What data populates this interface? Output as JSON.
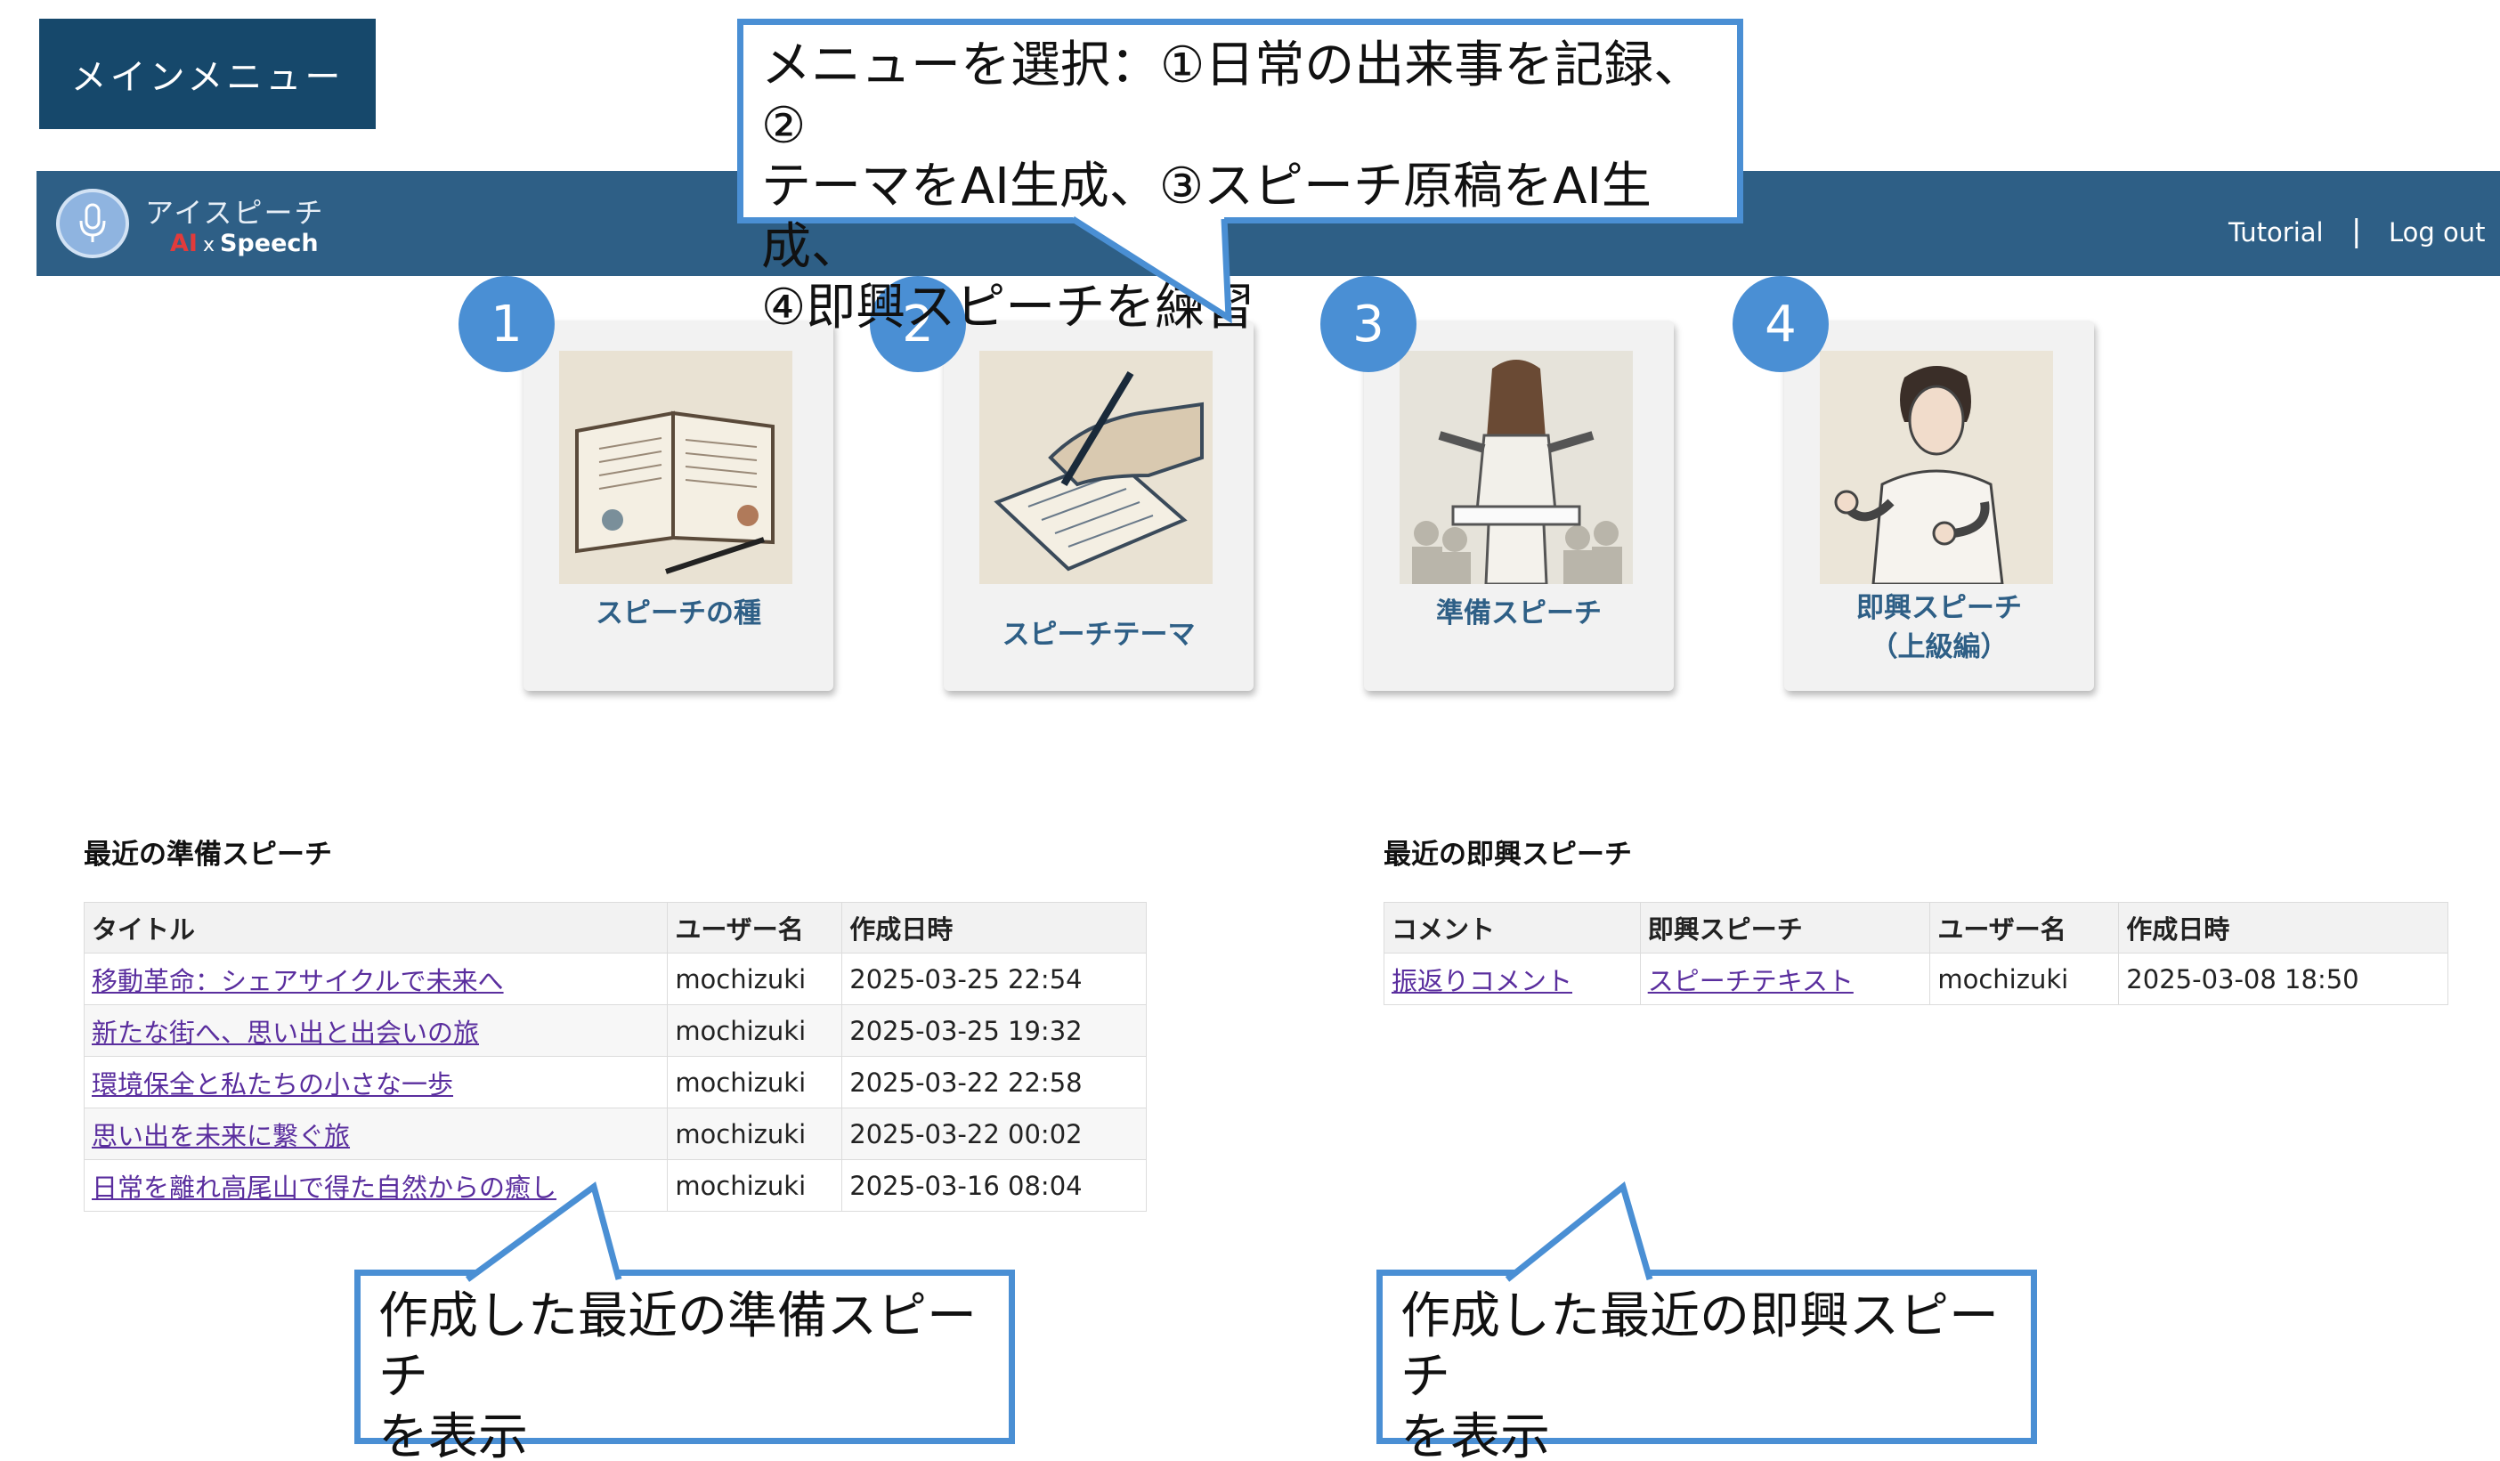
{
  "page_label": "メインメニュー",
  "header": {
    "brand_name": "アイスピーチ",
    "brand_sub_ai": "AI",
    "brand_sub_x": "x",
    "brand_sub_speech": "Speech",
    "nav_tutorial": "Tutorial",
    "nav_separator": "|",
    "nav_logout": "Log out"
  },
  "callouts": {
    "top_line1": "メニューを選択：①日常の出来事を記録、②",
    "top_line2": "テーマをAI生成、③スピーチ原稿をAI生成、",
    "top_line3": "④即興スピーチを練習",
    "left_line1": "作成した最近の準備スピーチ",
    "left_line2": "を表示",
    "right_line1": "作成した最近の即興スピーチ",
    "right_line2": "を表示"
  },
  "menu_cards": [
    {
      "number": "1",
      "label": "スピーチの種",
      "icon": "open-diary-icon"
    },
    {
      "number": "2",
      "label": "スピーチテーマ",
      "icon": "writing-hand-icon"
    },
    {
      "number": "3",
      "label": "準備スピーチ",
      "icon": "podium-speaker-icon"
    },
    {
      "number": "4",
      "label_line1": "即興スピーチ",
      "label_line2": "（上級編）",
      "icon": "gesturing-man-icon"
    }
  ],
  "prepared_speeches": {
    "title": "最近の準備スピーチ",
    "headers": [
      "タイトル",
      "ユーザー名",
      "作成日時"
    ],
    "rows": [
      {
        "title": "移動革命：シェアサイクルで未来へ",
        "user": "mochizuki",
        "created": "2025-03-25 22:54"
      },
      {
        "title": "新たな街へ、思い出と出会いの旅",
        "user": "mochizuki",
        "created": "2025-03-25 19:32"
      },
      {
        "title": "環境保全と私たちの小さな一歩",
        "user": "mochizuki",
        "created": "2025-03-22 22:58"
      },
      {
        "title": "思い出を未来に繋ぐ旅",
        "user": "mochizuki",
        "created": "2025-03-22 00:02"
      },
      {
        "title": "日常を離れ高尾山で得た自然からの癒し",
        "user": "mochizuki",
        "created": "2025-03-16 08:04"
      }
    ]
  },
  "impromptu_speeches": {
    "title": "最近の即興スピーチ",
    "headers": [
      "コメント",
      "即興スピーチ",
      "ユーザー名",
      "作成日時"
    ],
    "rows": [
      {
        "comment": "振返りコメント",
        "speech": "スピーチテキスト",
        "user": "mochizuki",
        "created": "2025-03-08 18:50"
      }
    ]
  },
  "colors": {
    "header_bar": "#2e5f86",
    "title_box": "#16486b",
    "callout_border": "#4a8fd4",
    "badge": "#4a8fd4",
    "card_label": "#2e5f86",
    "link": "#5a2e9e"
  }
}
